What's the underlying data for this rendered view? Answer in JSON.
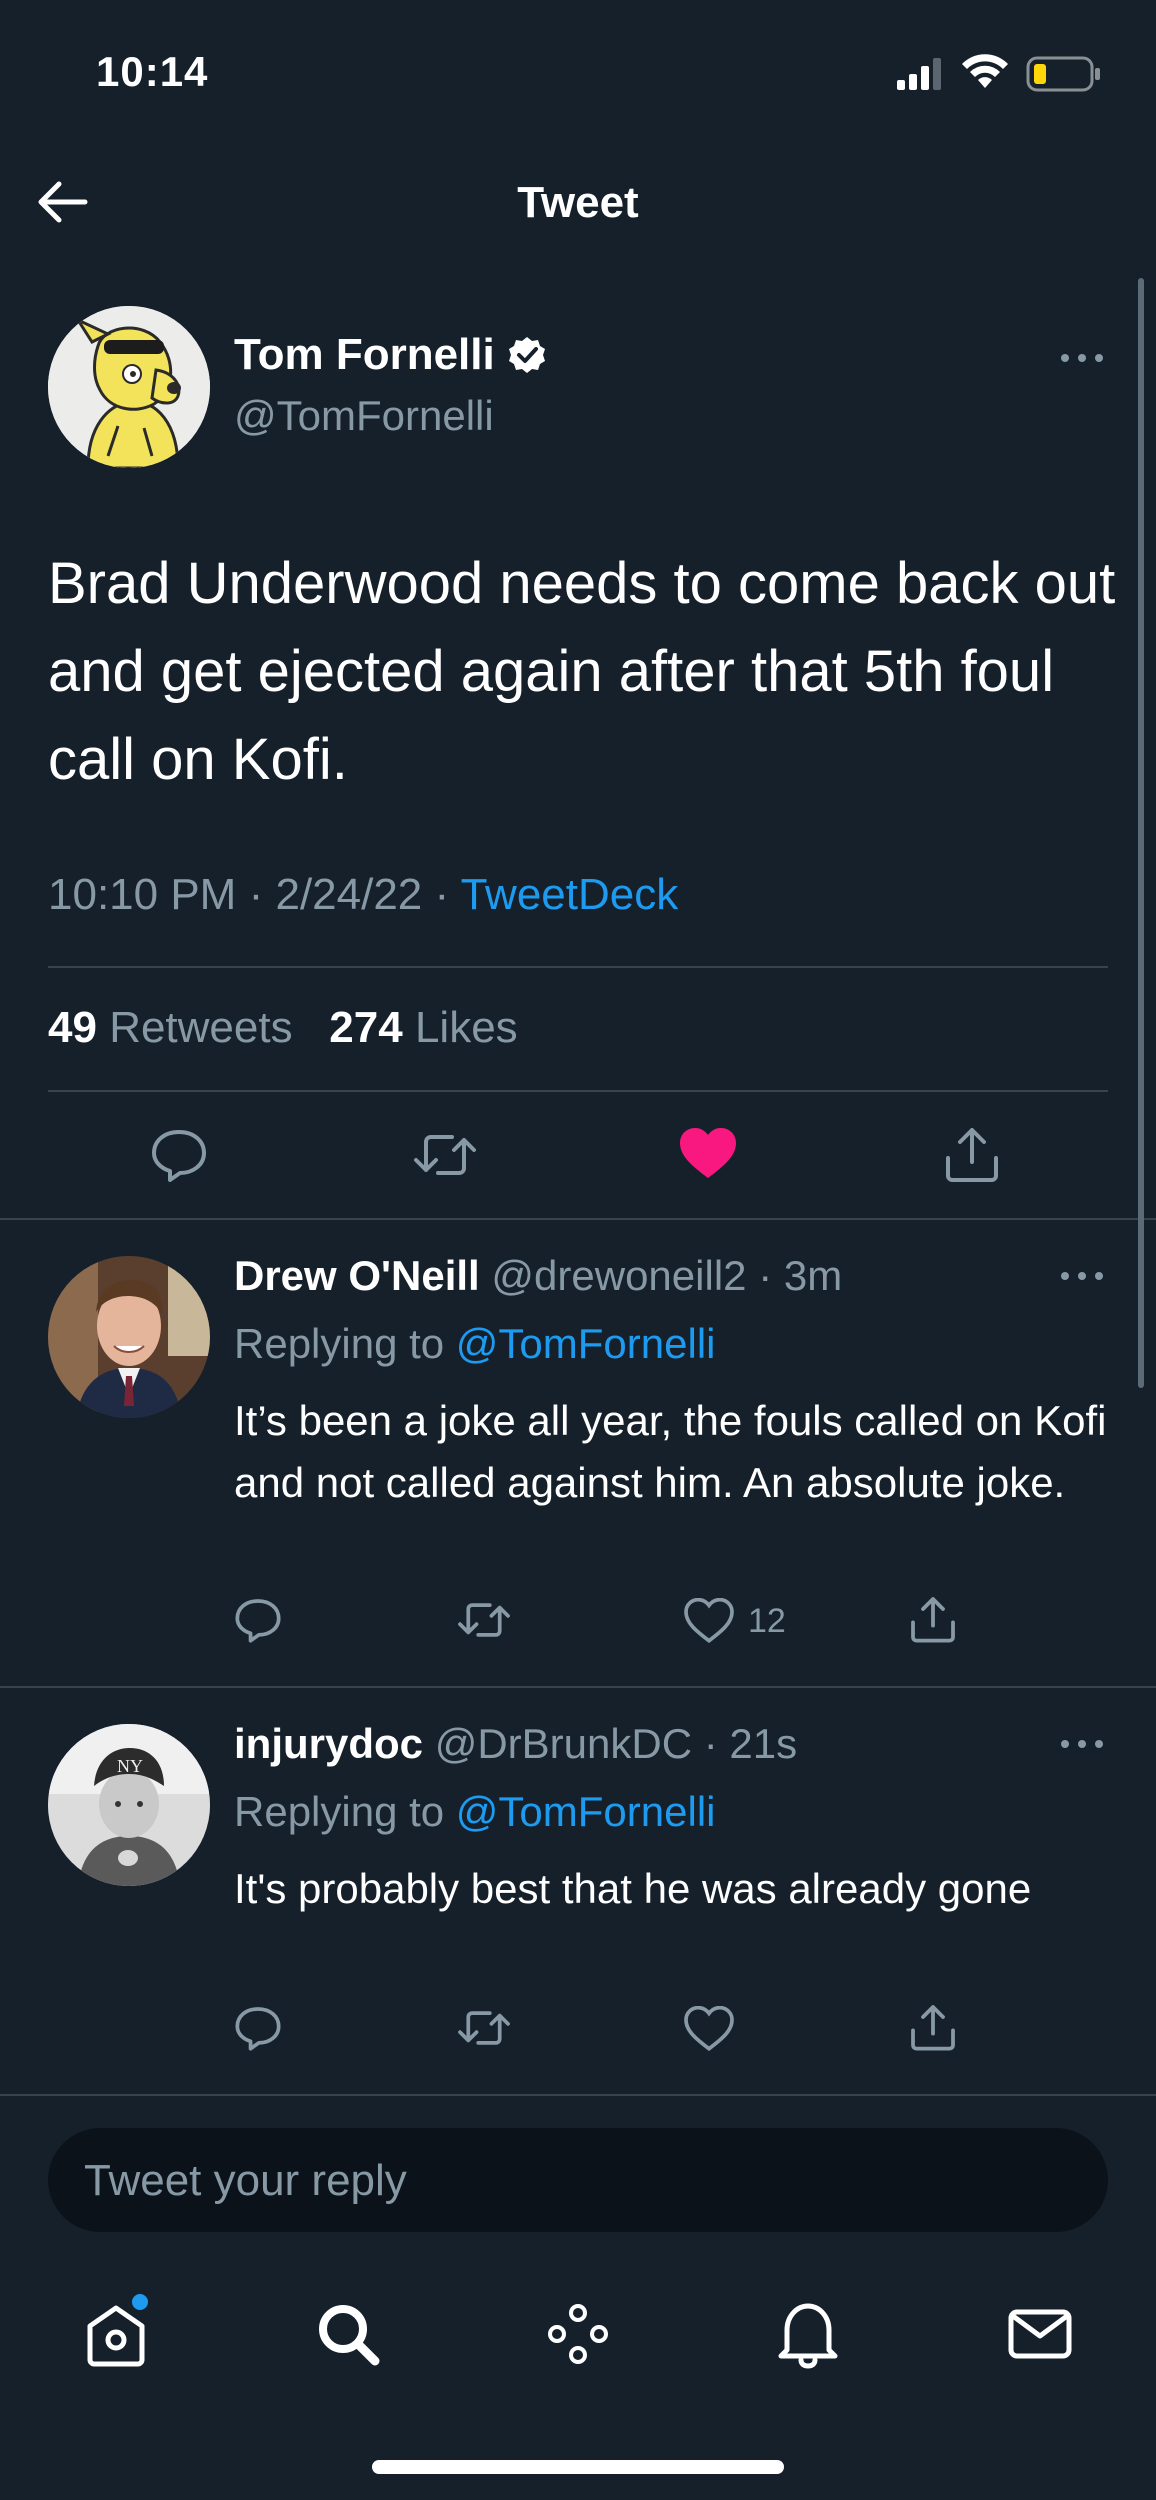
{
  "status_bar": {
    "time": "10:14"
  },
  "header": {
    "title": "Tweet"
  },
  "tweet": {
    "author_name": "Tom Fornelli",
    "author_handle": "@TomFornelli",
    "text": "Brad Underwood needs to come back out and get ejected again after that 5th foul call on Kofi.",
    "time": "10:10 PM",
    "date": "2/24/22",
    "source": "TweetDeck",
    "meta_separator": "·",
    "retweets_count": "49",
    "retweets_label": "Retweets",
    "likes_count": "274",
    "likes_label": "Likes",
    "liked": true
  },
  "replies": [
    {
      "name": "Drew O'Neill",
      "handle": "@drewoneill2",
      "time": "3m",
      "replying_prefix": "Replying to",
      "replying_to": "@TomFornelli",
      "text": "It’s been a joke all year, the fouls called on Kofi and not called against him. An absolute joke.",
      "like_count": "12"
    },
    {
      "name": "injurydoc",
      "handle": "@DrBrunkDC",
      "time": "21s",
      "replying_prefix": "Replying to",
      "replying_to": "@TomFornelli",
      "text": "It's probably best that he was already gone",
      "like_count": ""
    }
  ],
  "composer": {
    "placeholder": "Tweet your reply"
  },
  "tab_bar": {
    "items": [
      "home-icon",
      "search-icon",
      "spaces-icon",
      "notifications-icon",
      "messages-icon"
    ],
    "home_has_badge": true
  },
  "colors": {
    "background": "#15202b",
    "accent": "#1d9bf0",
    "like": "#f91880",
    "muted": "#8899a6",
    "divider": "#38444d"
  }
}
